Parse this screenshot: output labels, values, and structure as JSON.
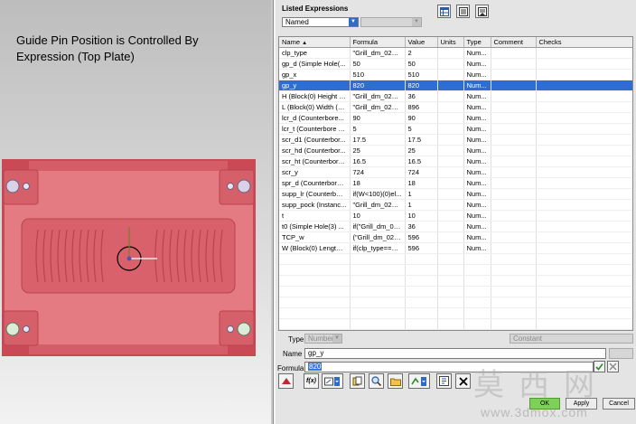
{
  "caption": {
    "line1": "Guide Pin Position is Controlled By",
    "line2": "Expression (Top Plate)"
  },
  "colors": {
    "plate": "#e0666f",
    "plate_dark": "#c04550",
    "selection": "#2f6dd0",
    "ok": "#7fd05a"
  },
  "dialog": {
    "group_title": "Listed Expressions",
    "listed_select": "Named",
    "columns": [
      "Name",
      "Formula",
      "Value",
      "Units",
      "Type",
      "Comment",
      "Checks"
    ],
    "selected_index": 3,
    "rows": [
      {
        "name": "clp_type",
        "formula": "\"Grill_dm_025\"...",
        "value": "2",
        "type": "Num..."
      },
      {
        "name": "gp_d (Simple Hole(...",
        "formula": "50",
        "value": "50",
        "type": "Num..."
      },
      {
        "name": "gp_x",
        "formula": "510",
        "value": "510",
        "type": "Num..."
      },
      {
        "name": "gp_y",
        "formula": "820",
        "value": "820",
        "type": "Num..."
      },
      {
        "name": "H (Block(0) Height (...",
        "formula": "\"Grill_dm_025\"...",
        "value": "36",
        "type": "Num..."
      },
      {
        "name": "L (Block(0) Width (Y...",
        "formula": "\"Grill_dm_025\"...",
        "value": "896",
        "type": "Num..."
      },
      {
        "name": "lcr_d (Counterbore...",
        "formula": "90",
        "value": "90",
        "type": "Num..."
      },
      {
        "name": "lcr_t (Counterbore H...",
        "formula": "5",
        "value": "5",
        "type": "Num..."
      },
      {
        "name": "scr_d1 (Counterbor...",
        "formula": "17.5",
        "value": "17.5",
        "type": "Num..."
      },
      {
        "name": "scr_hd (Counterbor...",
        "formula": "25",
        "value": "25",
        "type": "Num..."
      },
      {
        "name": "scr_ht (Counterbore...",
        "formula": "16.5",
        "value": "16.5",
        "type": "Num..."
      },
      {
        "name": "scr_y",
        "formula": "724",
        "value": "724",
        "type": "Num..."
      },
      {
        "name": "spr_d (Counterbore ...",
        "formula": "18",
        "value": "18",
        "type": "Num..."
      },
      {
        "name": "supp_lr (Counterbor...",
        "formula": "if(W<100)(0)el...",
        "value": "1",
        "type": "Num..."
      },
      {
        "name": "supp_pock (Instanc...",
        "formula": "\"Grill_dm_025\"...",
        "value": "1",
        "type": "Num..."
      },
      {
        "name": "t",
        "formula": "10",
        "value": "10",
        "type": "Num..."
      },
      {
        "name": "t0 (Simple Hole(3) ...",
        "formula": "if(\"Grill_dm_02...",
        "value": "36",
        "type": "Num..."
      },
      {
        "name": "TCP_w",
        "formula": "(\"Grill_dm_025...",
        "value": "596",
        "type": "Num..."
      },
      {
        "name": "W (Block(0) Length (...",
        "formula": "if(clp_type==1)...",
        "value": "596",
        "type": "Num..."
      }
    ],
    "type_label": "Type",
    "type_value": "Number",
    "constant_value": "Constant",
    "name_label": "Name",
    "name_value": "gp_y",
    "formula_label": "Formula",
    "formula_value": "820",
    "fx_label": "f(x)",
    "ok_label": "OK",
    "apply_label": "Apply",
    "cancel_label": "Cancel"
  },
  "watermark": {
    "text": "莫西网",
    "url": "www.3dmox.com"
  }
}
